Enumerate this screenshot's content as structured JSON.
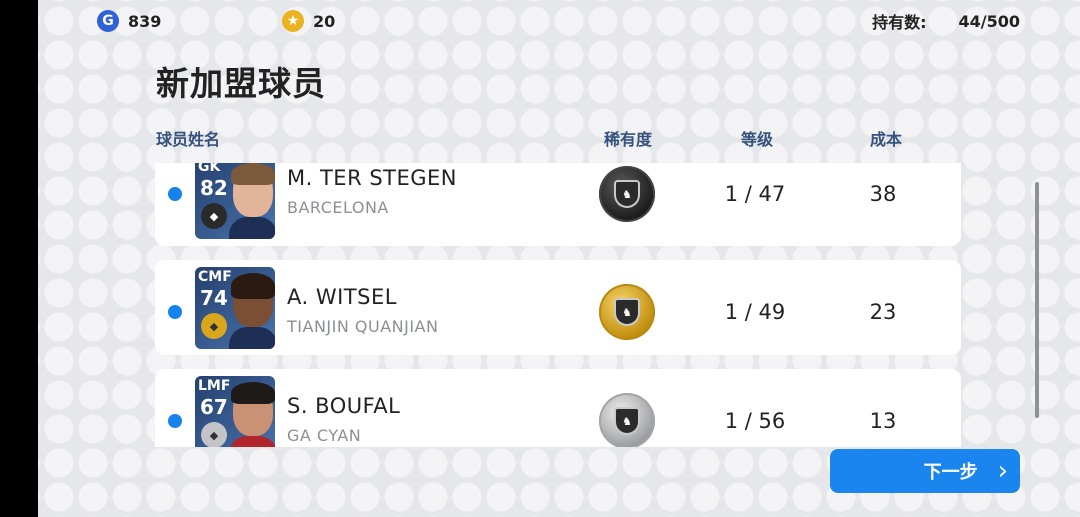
{
  "header": {
    "gp_value": "839",
    "coins_value": "20",
    "holding_label": "持有数:",
    "holding_value": "44/500"
  },
  "page_title": "新加盟球员",
  "columns": {
    "name": "球员姓名",
    "rarity": "稀有度",
    "level": "等级",
    "cost": "成本"
  },
  "players": [
    {
      "position": "GK",
      "rating": "82",
      "name": "M. TER STEGEN",
      "club": "BARCELONA",
      "rarity": "black",
      "level": "1 / 47",
      "cost": "38"
    },
    {
      "position": "CMF",
      "rating": "74",
      "name": "A. WITSEL",
      "club": "TIANJIN QUANJIAN",
      "rarity": "gold",
      "level": "1 / 49",
      "cost": "23"
    },
    {
      "position": "LMF",
      "rating": "67",
      "name": "S. BOUFAL",
      "club": "GA CYAN",
      "rarity": "silver",
      "level": "1 / 56",
      "cost": "13"
    }
  ],
  "rarity_colors": {
    "black": "#2a2a2a",
    "gold": "#d9a71c",
    "silver": "#b9bbbe"
  },
  "next_button": {
    "label": "下一步"
  },
  "icons": {
    "gp": "gp-coin-icon",
    "coin": "star-coin-icon",
    "next": "chevron-right-icon"
  }
}
